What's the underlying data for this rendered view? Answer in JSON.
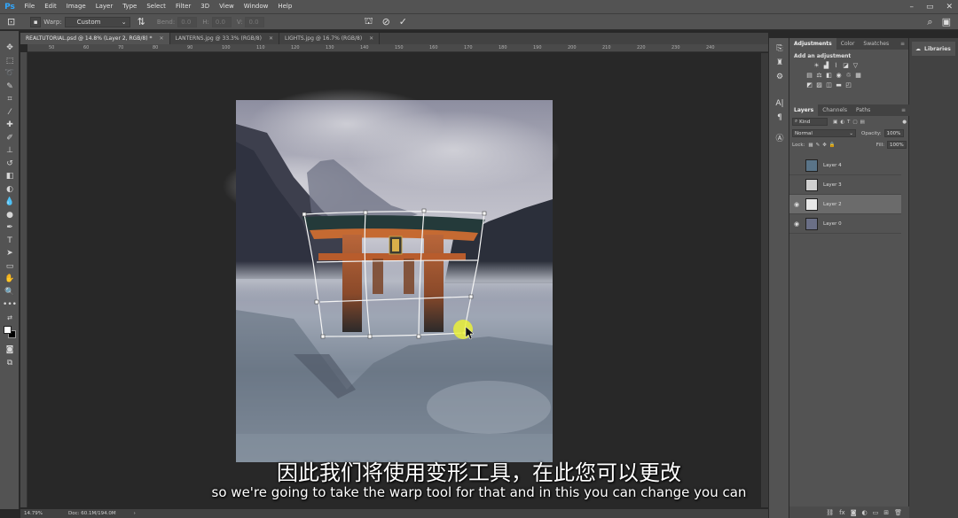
{
  "app": {
    "logo": "Ps"
  },
  "menu": [
    "File",
    "Edit",
    "Image",
    "Layer",
    "Type",
    "Select",
    "Filter",
    "3D",
    "View",
    "Window",
    "Help"
  ],
  "options": {
    "warp_label": "Warp:",
    "warp_value": "Custom",
    "bend_label": "Bend:",
    "bend_value": "0.0",
    "h_label": "H:",
    "h_value": "0.0",
    "v_label": "V:",
    "v_value": "0.0"
  },
  "tabs": [
    {
      "label": "REALTUTORIAL.psd @ 14.8% (Layer 2, RGB/8) *",
      "active": true
    },
    {
      "label": "LANTERNS.jpg @ 33.3% (RGB/8)",
      "active": false
    },
    {
      "label": "LIGHTS.jpg @ 16.7% (RGB/8)",
      "active": false
    }
  ],
  "ruler_ticks": [
    "50",
    "60",
    "70",
    "80",
    "90",
    "100",
    "110",
    "120",
    "130",
    "140",
    "150",
    "160",
    "170",
    "180",
    "190",
    "200",
    "210",
    "220",
    "230",
    "240"
  ],
  "status": {
    "zoom": "14.79%",
    "doc": "Doc: 60.1M/194.0M"
  },
  "adjustments_panel": {
    "tabs": [
      "Adjustments",
      "Color",
      "Swatches"
    ],
    "title": "Add an adjustment"
  },
  "layers_panel": {
    "tabs": [
      "Layers",
      "Channels",
      "Paths"
    ],
    "kind_placeholder": "Kind",
    "blend_mode": "Normal",
    "opacity_label": "Opacity:",
    "opacity_value": "100%",
    "lock_label": "Lock:",
    "fill_label": "Fill:",
    "fill_value": "100%",
    "layers": [
      {
        "name": "Layer 4",
        "visible": false,
        "selected": false,
        "thumb_color": "#5a7488"
      },
      {
        "name": "Layer 3",
        "visible": false,
        "selected": false,
        "thumb_color": "#cfcfcf"
      },
      {
        "name": "Layer 2",
        "visible": true,
        "selected": true,
        "thumb_color": "#e8e8e8"
      },
      {
        "name": "Layer 0",
        "visible": true,
        "selected": false,
        "thumb_color": "#6a6f86"
      }
    ]
  },
  "libraries": {
    "label": "Libraries"
  },
  "subtitles": {
    "cn": "因此我们将使用变形工具，在此您可以更改",
    "en": "so we're going to take the warp tool for that and in this you can change you can"
  },
  "colors": {
    "accent": "#31a8ff",
    "panel": "#535353",
    "canvas_bg": "#282828"
  }
}
